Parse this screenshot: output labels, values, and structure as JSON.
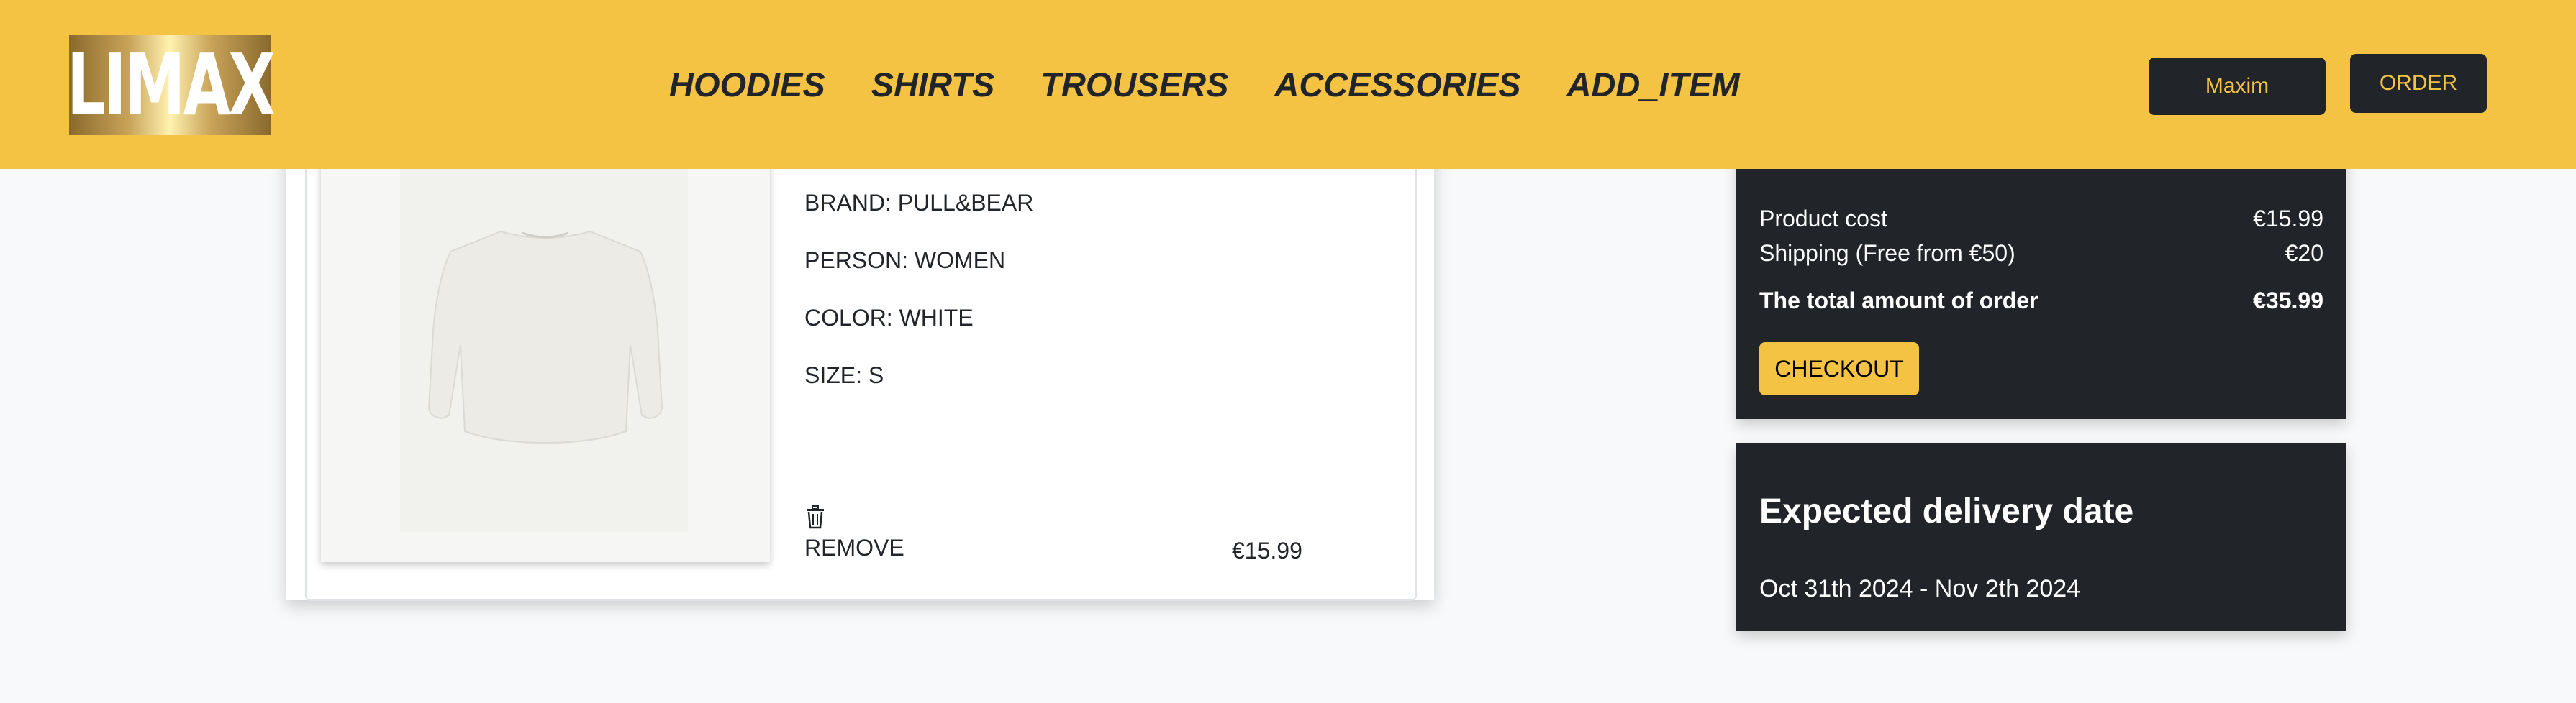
{
  "header": {
    "logo_text": "LIMAX",
    "nav": [
      "HOODIES",
      "SHIRTS",
      "TROUSERS",
      "ACCESSORIES",
      "ADD_ITEM"
    ],
    "user_button": "Maxim",
    "order_button": "ORDER",
    "colors": {
      "accent": "#f5c344",
      "dark": "#212529"
    }
  },
  "cart_item": {
    "brand": "BRAND: PULL&BEAR",
    "person": "PERSON: WOMEN",
    "color": "COLOR: WHITE",
    "size": "SIZE: S",
    "trash_icon": "trash-icon",
    "remove_label": "REMOVE",
    "price": "€15.99"
  },
  "summary": {
    "product_cost_label": "Product cost",
    "product_cost_value": "€15.99",
    "shipping_label": "Shipping (Free from €50)",
    "shipping_value": "€20",
    "total_label": "The total amount of order",
    "total_value": "€35.99",
    "checkout_label": "CHECKOUT"
  },
  "delivery": {
    "title": "Expected delivery date",
    "date_range": "Oct 31th 2024 - Nov 2th 2024"
  }
}
